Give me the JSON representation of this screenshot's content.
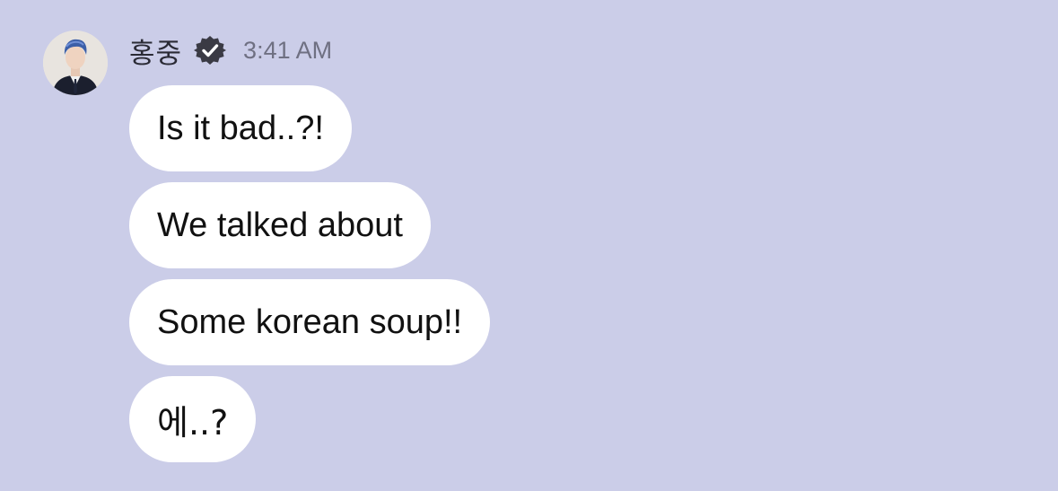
{
  "message_group": {
    "sender_name": "홍중",
    "timestamp": "3:41 AM",
    "avatar_icon": "profile-photo",
    "verified_icon": "verified-badge-icon",
    "colors": {
      "background": "#cbcde8",
      "bubble": "#ffffff",
      "text": "#111111",
      "timestamp": "#6f7082",
      "badge": "#3a3a44"
    },
    "messages": [
      {
        "text": "Is it bad..?!"
      },
      {
        "text": "We talked about"
      },
      {
        "text": "Some korean soup!!"
      },
      {
        "text": "에..?"
      }
    ]
  }
}
